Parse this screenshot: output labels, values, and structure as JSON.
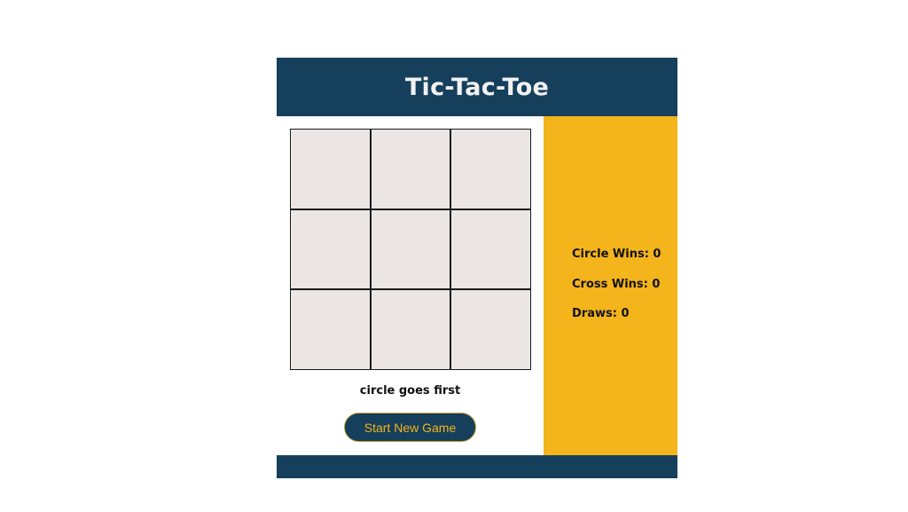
{
  "header": {
    "title": "Tic-Tac-Toe"
  },
  "board": {
    "cells": [
      "",
      "",
      "",
      "",
      "",
      "",
      "",
      "",
      ""
    ]
  },
  "status": {
    "message": "circle goes first"
  },
  "controls": {
    "new_game_label": "Start New Game"
  },
  "scoreboard": {
    "circle_wins": "Circle Wins: 0",
    "cross_wins": "Cross Wins: 0",
    "draws": "Draws: 0"
  },
  "colors": {
    "header_footer": "#163f5c",
    "sidebar": "#f4b41c",
    "cell": "#ebe5e5",
    "button_text": "#f4b41c"
  }
}
